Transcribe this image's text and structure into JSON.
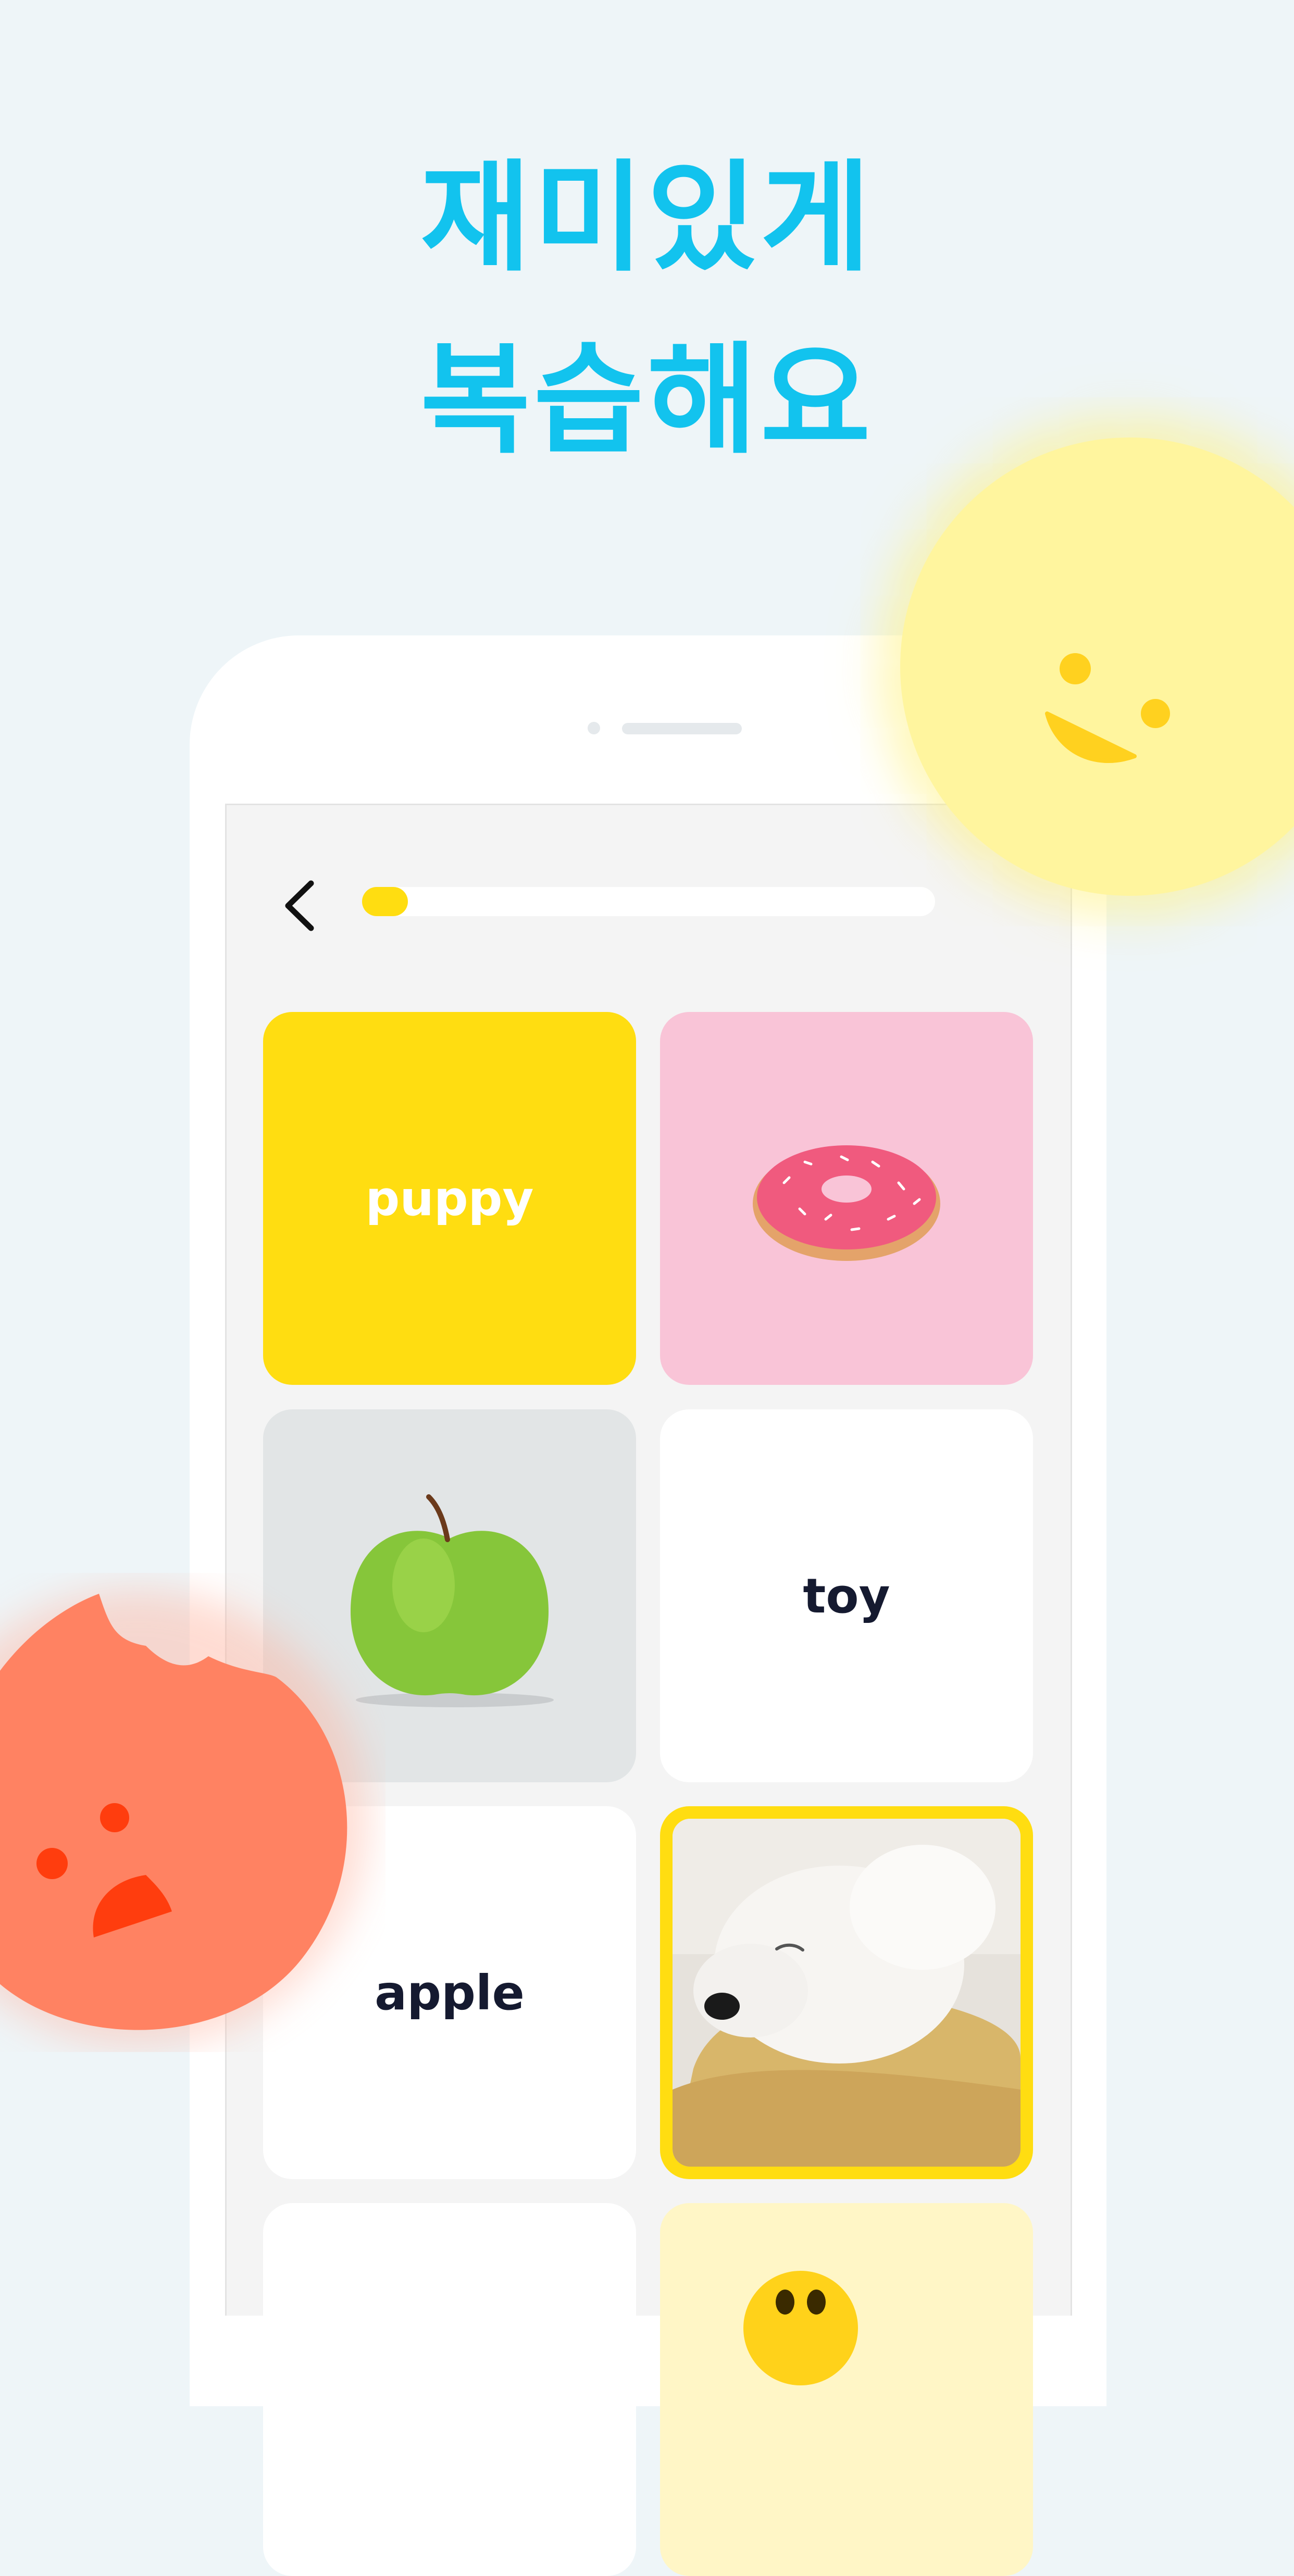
{
  "headline": {
    "line1": "재미있게",
    "line2": "복습해요"
  },
  "header": {
    "progress": 0.08
  },
  "cards": [
    {
      "word": "puppy"
    },
    {
      "image": "donut-image"
    },
    {
      "image": "apple-image"
    },
    {
      "word": "toy"
    },
    {
      "word": "apple"
    },
    {
      "image": "dog-image",
      "selected": true
    },
    {
      "word": ""
    },
    {
      "image": "emoji-image"
    }
  ],
  "colors": {
    "accent": "#12c3ee",
    "progress": "#ffdd11",
    "background": "#eef5f8",
    "yellow_character": "#fff59e",
    "red_character": "#ff8262"
  }
}
